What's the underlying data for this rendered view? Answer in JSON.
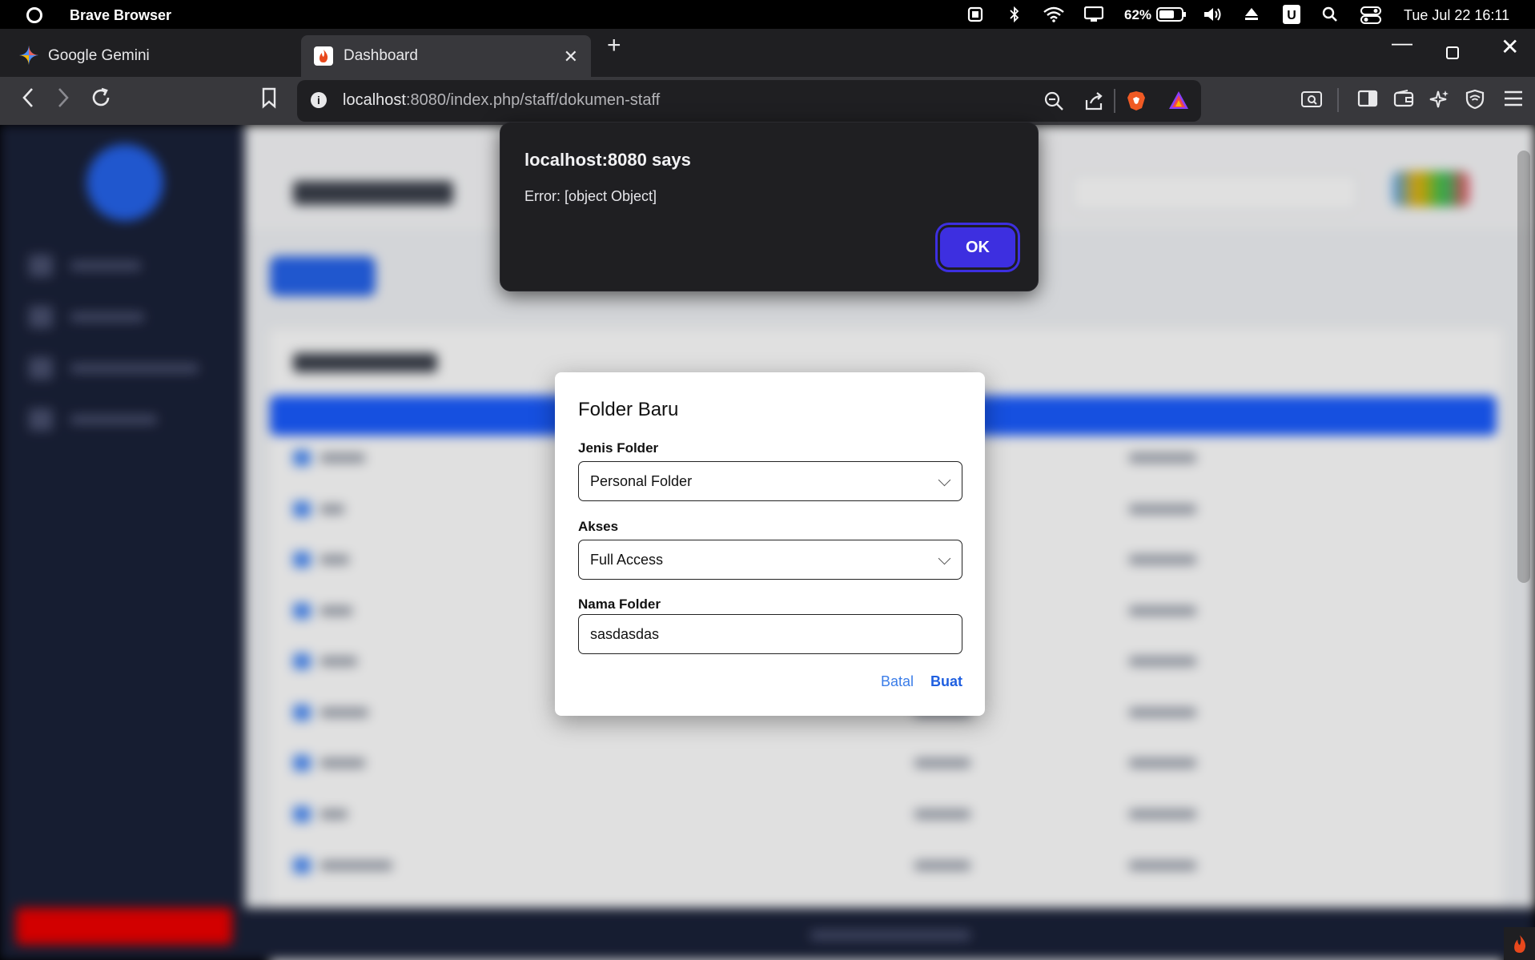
{
  "os": {
    "app_name": "Brave Browser",
    "battery": "62%",
    "clock": "Tue Jul 22 16:11",
    "tray_u": "U"
  },
  "tabs": [
    {
      "title": "Google Gemini",
      "active": false
    },
    {
      "title": "Dashboard",
      "active": true
    }
  ],
  "toolbar": {
    "url_host": "localhost",
    "url_rest": ":8080/index.php/staff/dokumen-staff"
  },
  "alert": {
    "title": "localhost:8080 says",
    "message": "Error: [object Object]",
    "ok_label": "OK",
    "ok_color": "#3d2fe0"
  },
  "modal": {
    "title": "Folder Baru",
    "jenis_label": "Jenis Folder",
    "jenis_value": "Personal Folder",
    "akses_label": "Akses",
    "akses_value": "Full Access",
    "nama_label": "Nama Folder",
    "nama_value": "sasdasdas",
    "cancel_label": "Batal",
    "create_label": "Buat"
  },
  "colors": {
    "sidebar": "#1a2138",
    "accent": "#2563eb",
    "table_header": "#1a5cff",
    "logout": "#ef0000"
  }
}
